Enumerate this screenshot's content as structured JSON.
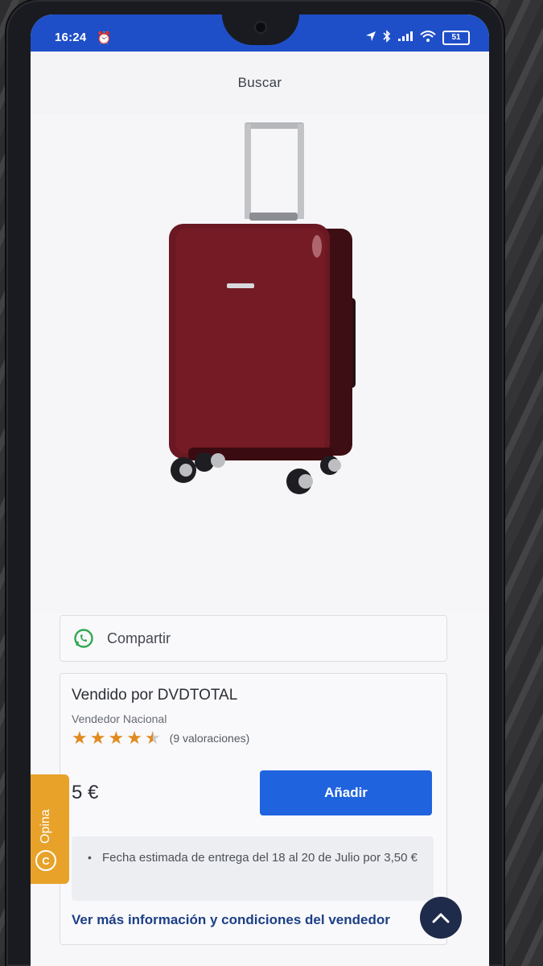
{
  "status_bar": {
    "time": "16:24",
    "alarm_icon": "alarm-icon",
    "battery_level": "51",
    "icons": [
      "location-arrow-icon",
      "bluetooth-icon",
      "signal-icon",
      "wifi-icon",
      "battery-icon"
    ]
  },
  "header": {
    "title": "Buscar"
  },
  "product": {
    "image_icon": "suitcase-image"
  },
  "share": {
    "label": "Compartir",
    "icon": "whatsapp-icon"
  },
  "seller": {
    "title": "Vendido por DVDTOTAL",
    "type": "Vendedor Nacional",
    "rating_value": 4.5,
    "ratings_text": "(9 valoraciones)",
    "price": "5 €",
    "add_button": "Añadir",
    "delivery_text": "Fecha estimada de entrega del 18 al 20 de Julio por 3,50 €",
    "more_info_link": "Ver más información y condiciones del vendedor"
  },
  "opina": {
    "label": "Opina",
    "icon_glyph": "C"
  },
  "colors": {
    "status_bar": "#1f4fc8",
    "primary_button": "#1f63de",
    "star": "#e08a1f",
    "opina": "#e8a22a",
    "scroll_button": "#1f2b4a",
    "link": "#1d3f86"
  }
}
